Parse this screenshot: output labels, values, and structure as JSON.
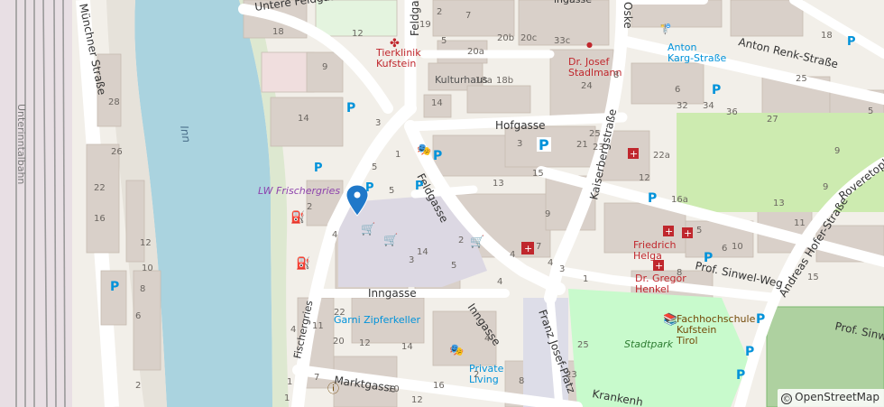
{
  "streets": {
    "untere_feldgasse": "Untere Feldgasse",
    "feldgasse_north": "Feldgasse",
    "feldgasse_south": "Feldgasse",
    "hofgasse": "Hofgasse",
    "kaiserbergstrasse": "Kaiserbergstraße",
    "anton_renk": "Anton Renk-Straße",
    "andreas_hofer": "Andreas Hofer-Straße",
    "roveretoplatz": "Roveretoplat",
    "prof_sinwel_weg": "Prof. Sinwel-Weg",
    "prof_sinwe": "Prof. Sinwe",
    "inngasse_h": "Inngasse",
    "inngasse_d": "Inngasse",
    "franz_josef_platz": "Franz Josef-Platz",
    "krankenhausgasse": "Krankenh",
    "marktgasse": "Marktgasse",
    "fischergries": "Fischergries",
    "muenchner_strasse": "Münchner Straße",
    "unterinntalbahn": "Unterinntalbahn",
    "kulturhaus": "Kulturhaus",
    "oskar": "Oske",
    "ingasse_top": "ingasse"
  },
  "water": {
    "river_label": "Inn"
  },
  "pois": {
    "tierklinik": "Tierklinik\nKufstein",
    "dr_josef": "Dr. Josef\nStadlmann",
    "anton_karg": "Anton\nKarg-Straße",
    "lw_frischergries": "LW Frischergries",
    "friedrich_helga": "Friedrich\nHelga",
    "dr_gregor": "Dr. Gregor\nHenkel",
    "garni": "Garni Zipferkeller",
    "private_living": "Private\nLiving",
    "fachhochschule": "Fachhochschule\nKufstein\nTirol",
    "stadtpark": "Stadtpark"
  },
  "house_numbers": {
    "n18": "18",
    "n20c": "20c",
    "n20b": "20b",
    "n33c": "33c",
    "n12": "12",
    "n5a": "5",
    "n7": "7",
    "n20a": "20a",
    "n9": "9",
    "n14a": "14",
    "n3a": "3",
    "n14b": "14",
    "n18a": "18a",
    "n18b": "18b",
    "n1a": "1",
    "n5b": "5",
    "n2a": "2",
    "n13": "13",
    "n3b": "3",
    "n2b": "2",
    "n4a": "4",
    "n5c": "5",
    "n3c": "3",
    "n15": "15",
    "n21": "21",
    "n23": "23",
    "n25": "25",
    "n22a": "22a",
    "n16a": "16a",
    "n24": "24",
    "n6": "6",
    "n8": "8",
    "n10": "10",
    "n32": "32",
    "n34": "34",
    "n36": "36",
    "n28": "28",
    "n26": "26",
    "n22b": "22",
    "n16": "16",
    "n12b": "12",
    "n10b": "10",
    "n8b": "8",
    "n6b": "6",
    "n2c": "2",
    "n22c": "22",
    "n20": "20",
    "n12c": "12",
    "n14c": "14",
    "n16c": "16",
    "n4b": "4",
    "n7b": "7",
    "n4c": "4",
    "n9b": "9",
    "n3d": "3",
    "n1b": "1",
    "n8c": "8",
    "n4d": "4",
    "n2d": "2",
    "n10c": "10",
    "n12d": "12",
    "n1c": "1",
    "n4e": "4",
    "n11": "11",
    "n1d": "1",
    "n7c": "7",
    "n19": "19",
    "n2e": "2",
    "n23b": "23",
    "n25b": "25",
    "n5d": "5",
    "n6c": "6",
    "n8d": "8",
    "n12e": "12",
    "n11b": "11",
    "n9c": "9",
    "n13b": "13",
    "n15b": "15",
    "n18c": "18",
    "n25c": "25",
    "n27": "27",
    "n5e": "5",
    "n9d": "9",
    "n5f": "5",
    "n4f": "4",
    "n14d": "14"
  },
  "attribution": {
    "text": "OpenStreetMap",
    "symbol": "©"
  },
  "colors": {
    "road": "#ffffff",
    "road_outline": "#d9d0c9",
    "building": "#d9d0c9",
    "water": "#aad3df",
    "park": "#c8facc",
    "grass": "#cdebb0",
    "pedestrian": "#dddde8",
    "poi_red": "#c0272d",
    "poi_blue": "#0092da",
    "poi_purple": "#ac39ac",
    "poi_brown": "#734a08"
  }
}
